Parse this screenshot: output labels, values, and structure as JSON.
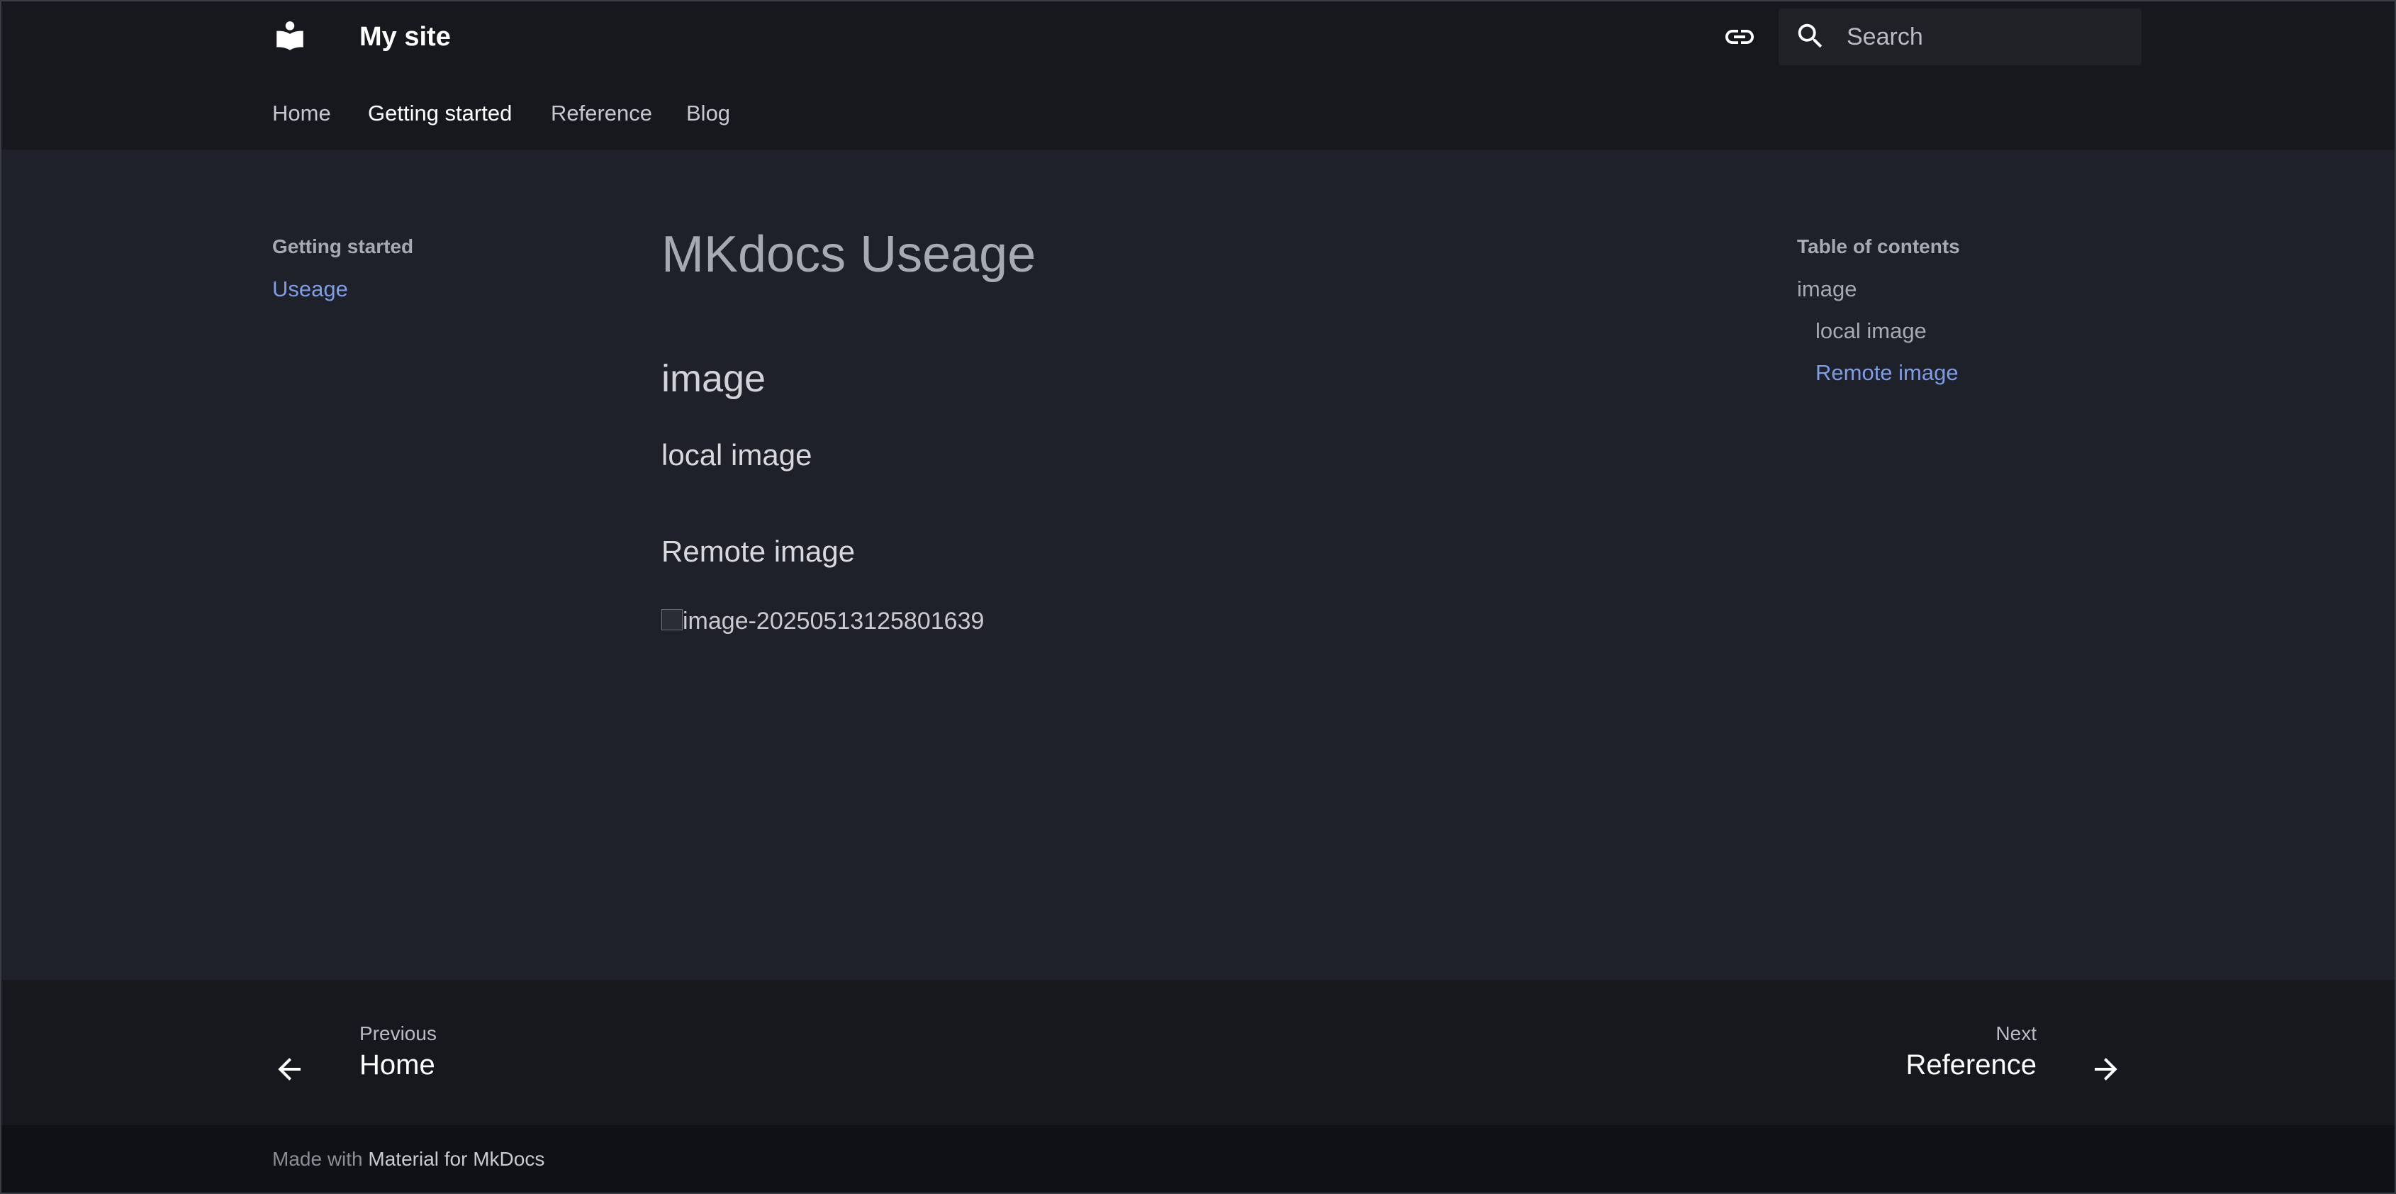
{
  "header": {
    "site_title": "My site",
    "logo_icon": "book-reader-icon",
    "source_icon": "link-icon",
    "search": {
      "placeholder": "Search",
      "icon": "search-icon"
    },
    "tabs": [
      {
        "label": "Home",
        "active": false
      },
      {
        "label": "Getting started",
        "active": true
      },
      {
        "label": "Reference",
        "active": false
      },
      {
        "label": "Blog",
        "active": false
      }
    ]
  },
  "sidebar": {
    "title": "Getting started",
    "items": [
      {
        "label": "Useage",
        "active": true
      }
    ]
  },
  "content": {
    "title": "MKdocs Useage",
    "h2_image": "image",
    "h3_local": "local image",
    "h3_remote": "Remote image",
    "broken_image_alt": "image-20250513125801639"
  },
  "toc": {
    "title": "Table of contents",
    "items": [
      {
        "label": "image",
        "level": 1,
        "active": false
      },
      {
        "label": "local image",
        "level": 2,
        "active": false
      },
      {
        "label": "Remote image",
        "level": 2,
        "active": true
      }
    ]
  },
  "footer_nav": {
    "previous": {
      "caption": "Previous",
      "title": "Home",
      "icon": "arrow-left-icon"
    },
    "next": {
      "caption": "Next",
      "title": "Reference",
      "icon": "arrow-right-icon"
    }
  },
  "footer_meta": {
    "prefix": "Made with ",
    "brand": "Material for MkDocs"
  },
  "colors": {
    "header_bg": "#16181d",
    "page_bg": "#1e2129",
    "accent_link": "#7f9de5",
    "footer_bg": "#0f1115"
  }
}
